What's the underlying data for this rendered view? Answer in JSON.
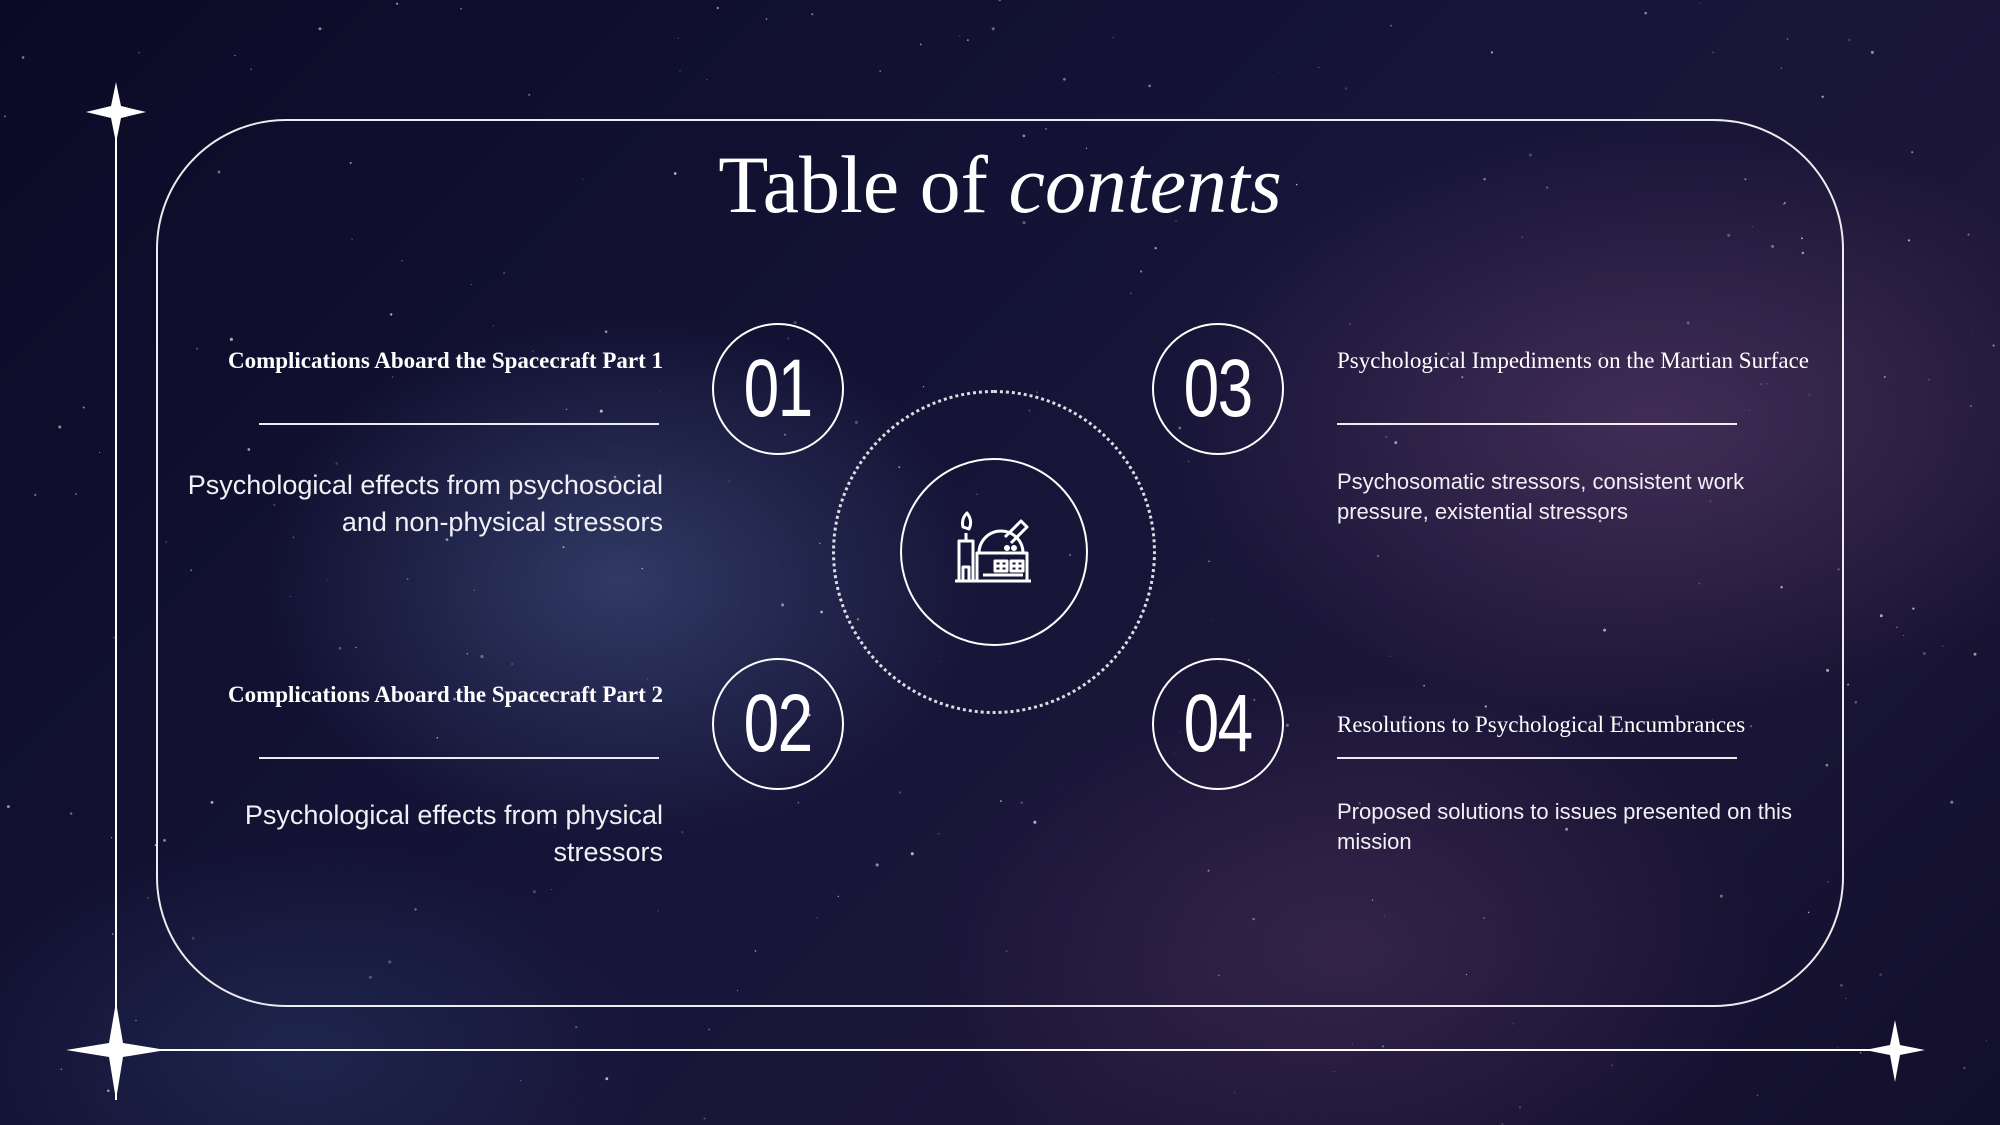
{
  "title": {
    "plain": "Table of ",
    "italic": "contents"
  },
  "center_icon": "observatory-icon",
  "sections": [
    {
      "number": "01",
      "heading": "Complications Aboard the Spacecraft Part 1",
      "description": "Psychological effects from psychosocial and non-physical stressors"
    },
    {
      "number": "02",
      "heading": "Complications Aboard the Spacecraft Part 2",
      "description": "Psychological effects from physical stressors"
    },
    {
      "number": "03",
      "heading": "Psychological Impediments on the Martian Surface",
      "description": "Psychosomatic stressors, consistent work pressure, existential stressors"
    },
    {
      "number": "04",
      "heading": "Resolutions to Psychological Encumbrances",
      "description": "Proposed solutions to issues presented on this mission"
    }
  ],
  "colors": {
    "background": "#131235",
    "line": "#ffffff",
    "text": "#ffffff"
  }
}
